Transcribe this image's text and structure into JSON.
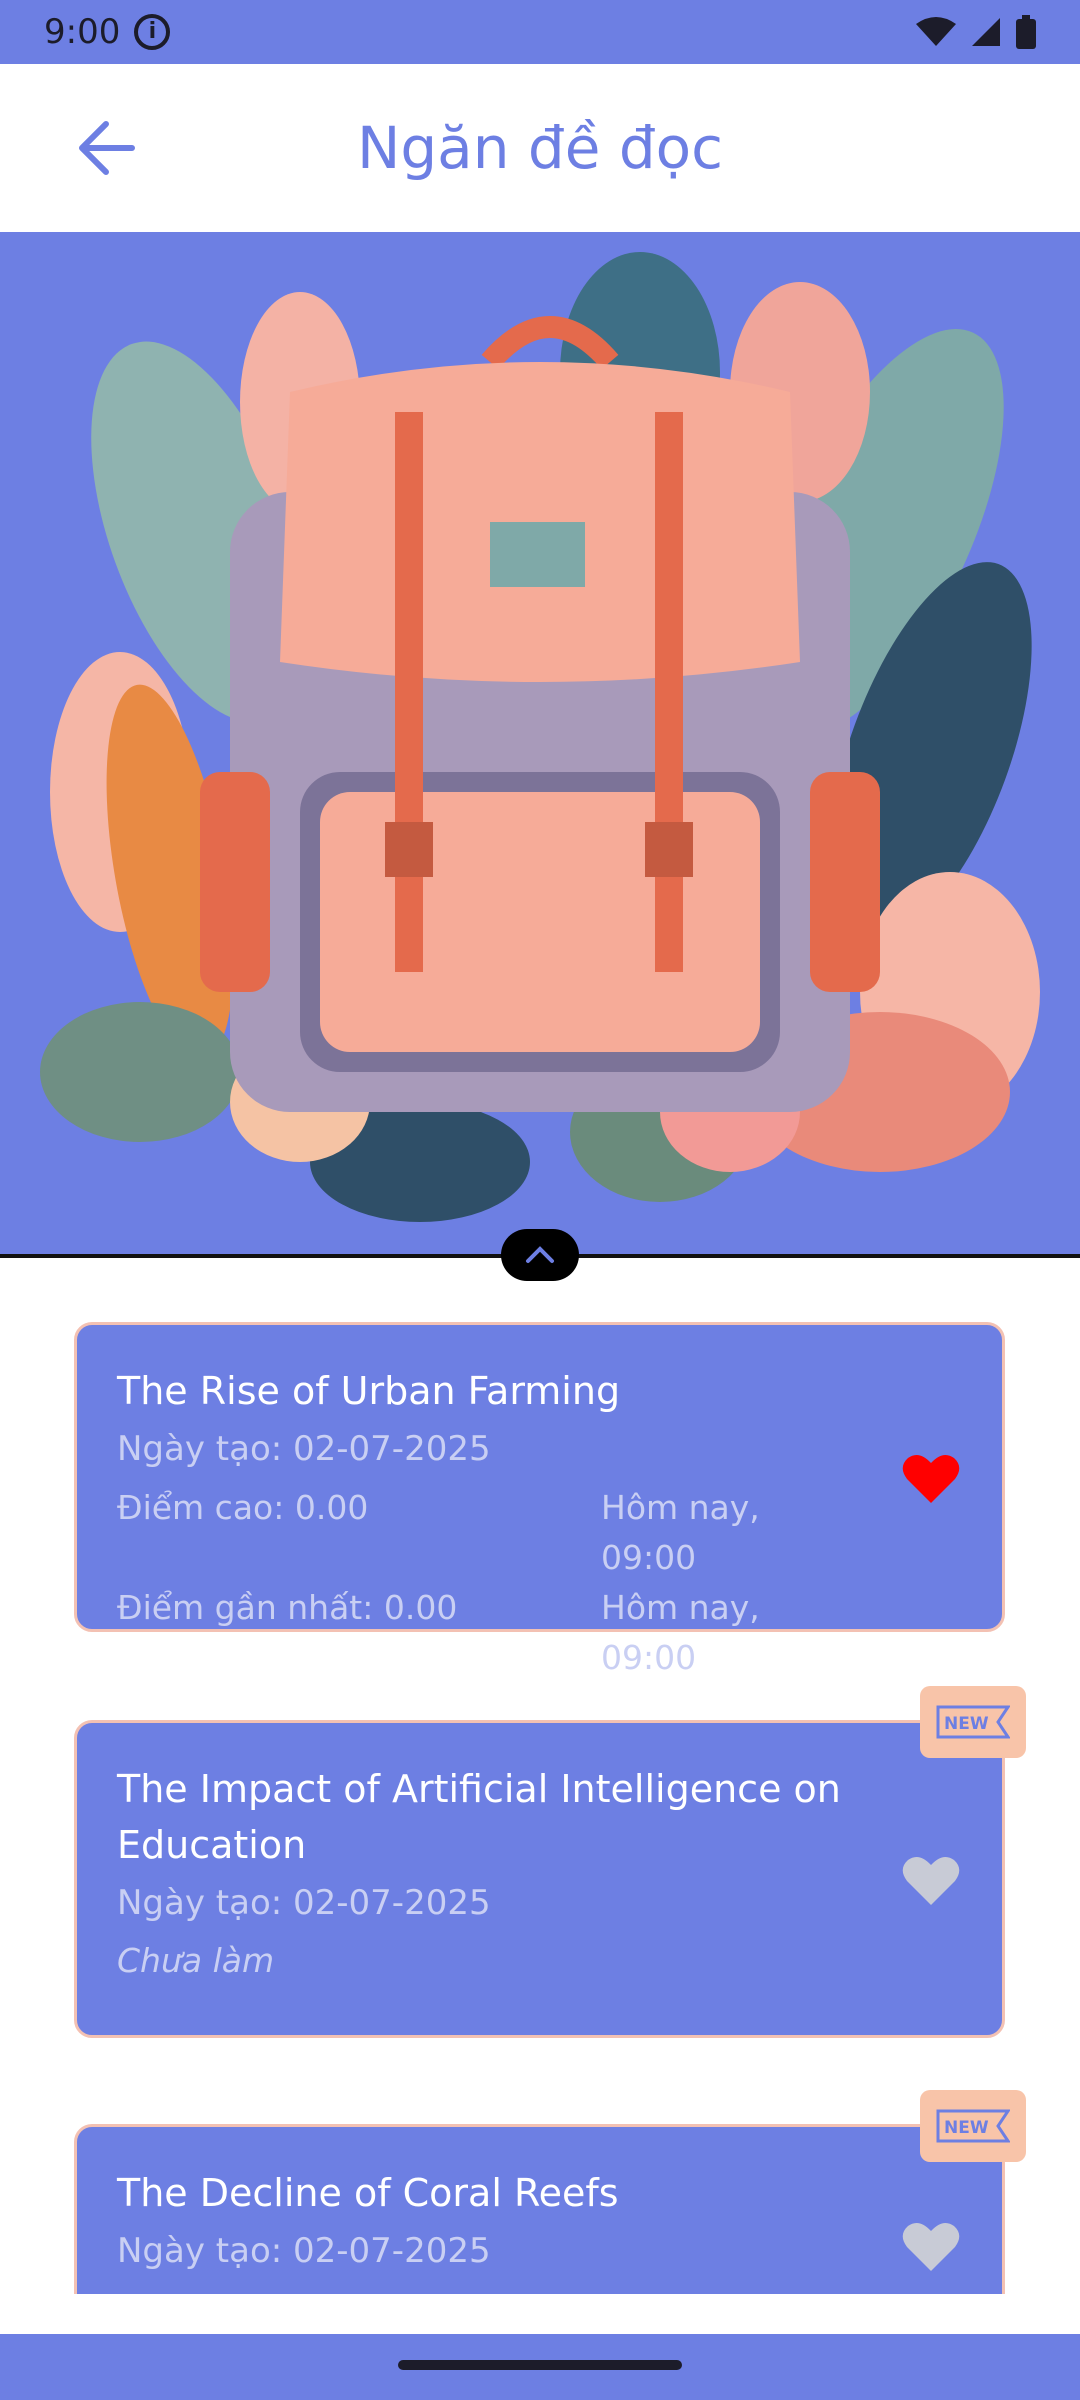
{
  "status_bar": {
    "time": "9:00"
  },
  "header": {
    "title": "Ngăn đề đọc"
  },
  "cards": [
    {
      "title": "The Rise of Urban Farming",
      "date": "Ngày tạo: 02-07-2025",
      "high_score": "Điểm cao: 0.00",
      "high_score_time": "Hôm nay, 09:00",
      "recent_score": "Điểm gần nhất: 0.00",
      "recent_score_time": "Hôm nay, 09:00",
      "favorite": true
    },
    {
      "title": "The Impact of Artificial Intelligence on Education",
      "date": "Ngày tạo: 02-07-2025",
      "status": "Chưa làm",
      "badge": "NEW",
      "favorite": false
    },
    {
      "title": "The Decline of Coral Reefs",
      "date": "Ngày tạo: 02-07-2025",
      "badge": "NEW",
      "favorite": false
    }
  ],
  "colors": {
    "primary": "#6d7fe3",
    "card_border": "#f3c1b3",
    "favorite_active": "#ff0000",
    "favorite_inactive": "#c8cbd6",
    "badge_bg": "#f8c4a9"
  }
}
